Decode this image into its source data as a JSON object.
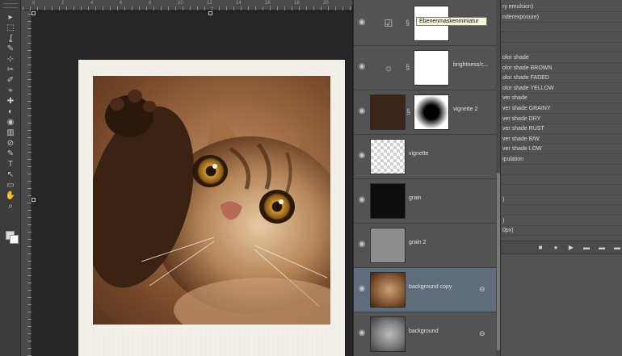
{
  "tooltip": "Ebenenmaskenminiatur",
  "ruler": {
    "numbers": [
      "0",
      "2",
      "4",
      "6",
      "8",
      "10",
      "12",
      "14",
      "16",
      "18",
      "20",
      "22"
    ]
  },
  "layers": [
    {
      "name": "",
      "type": "adjustment",
      "icon": "curves-icon",
      "glyph": "☑",
      "mask": "white"
    },
    {
      "name": "brightness/c...",
      "type": "adjustment",
      "icon": "brightness-icon",
      "glyph": "☼",
      "mask": "white"
    },
    {
      "name": "vignette 2",
      "type": "image-masked",
      "thumb": "brown",
      "mask": "vignette-mask"
    },
    {
      "name": "vignette",
      "type": "image",
      "thumb": "checker"
    },
    {
      "name": "grain",
      "type": "image",
      "thumb": "dark"
    },
    {
      "name": "grain 2",
      "type": "image",
      "thumb": "grey"
    },
    {
      "name": "background copy",
      "type": "image",
      "thumb": "cat",
      "linked": true,
      "selected": true
    },
    {
      "name": "background",
      "type": "image",
      "thumb": "cat2",
      "linked": true
    }
  ],
  "actions": {
    "rows": [
      "ry emulsion)",
      "nderexposure)",
      "",
      "",
      "",
      "olor shade",
      "olor shade BROWN",
      "olor shade FADED",
      "olor shade YELLOW",
      "ver shade",
      "ver shade GRAINY",
      "ver shade DRY",
      "ver shade RUST",
      "ver shade B/W",
      "ver shade LOW",
      "ipulation",
      "",
      "",
      "",
      ")",
      "",
      ")",
      "0px)"
    ],
    "toolbar": [
      "■",
      "●",
      "▶",
      "▬",
      "▬",
      "▬"
    ]
  },
  "colors": {
    "selected_layer": "#5e6c7c",
    "panel": "#535353",
    "canvas": "#262626"
  }
}
